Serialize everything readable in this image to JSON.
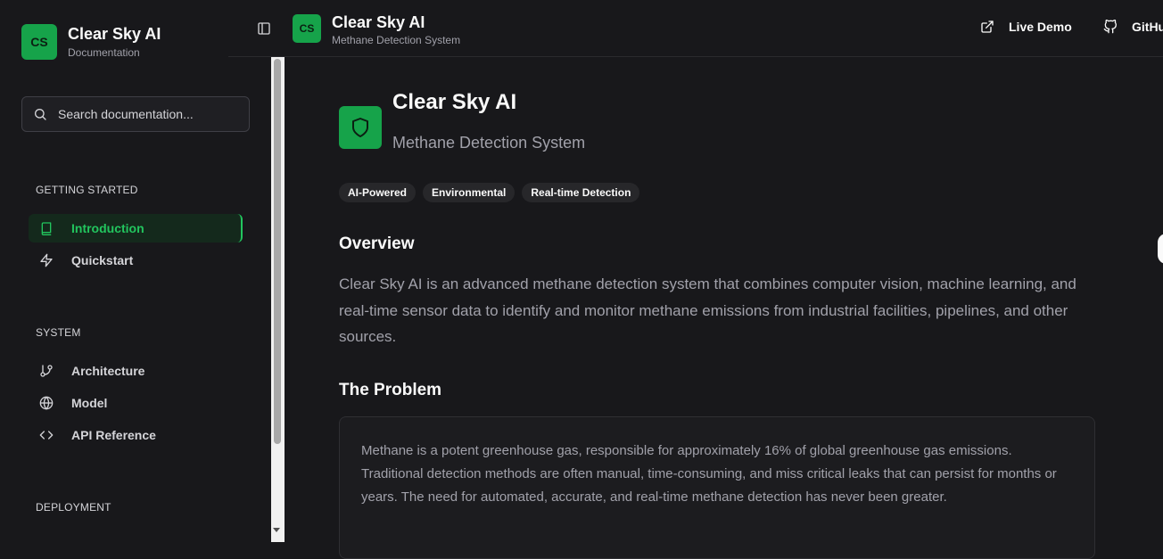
{
  "sidebar": {
    "logo_text": "CS",
    "title": "Clear Sky AI",
    "subtitle": "Documentation",
    "search_placeholder": "Search documentation...",
    "sections": [
      {
        "label": "GETTING STARTED",
        "items": [
          {
            "label": "Introduction",
            "icon": "book-icon",
            "active": true
          },
          {
            "label": "Quickstart",
            "icon": "zap-icon"
          }
        ]
      },
      {
        "label": "SYSTEM",
        "items": [
          {
            "label": "Architecture",
            "icon": "git-branch-icon"
          },
          {
            "label": "Model",
            "icon": "globe-icon"
          },
          {
            "label": "API Reference",
            "icon": "code-icon"
          }
        ]
      },
      {
        "label": "DEPLOYMENT",
        "items": []
      }
    ]
  },
  "header": {
    "logo_text": "CS",
    "title": "Clear Sky AI",
    "subtitle": "Methane Detection System",
    "links": [
      {
        "label": "Live Demo",
        "icon": "external-link-icon"
      },
      {
        "label": "GitHub",
        "icon": "github-icon"
      }
    ]
  },
  "main": {
    "title": "Clear Sky AI",
    "subtitle": "Methane Detection System",
    "tags": [
      "AI-Powered",
      "Environmental",
      "Real-time Detection"
    ],
    "overview_heading": "Overview",
    "overview_text": "Clear Sky AI is an advanced methane detection system that combines computer vision, machine learning, and real-time sensor data to identify and monitor methane emissions from industrial facilities, pipelines, and other sources.",
    "problem_heading": "The Problem",
    "problem_text": "Methane is a potent greenhouse gas, responsible for approximately 16% of global greenhouse gas emissions. Traditional detection methods are often manual, time-consuming, and miss critical leaks that can persist for months or years. The need for automated, accurate, and real-time methane detection has never been greater."
  },
  "colors": {
    "accent": "#22c55e",
    "accent_dark": "#16a34a",
    "background": "#18181b",
    "active_bg": "#14291c"
  }
}
